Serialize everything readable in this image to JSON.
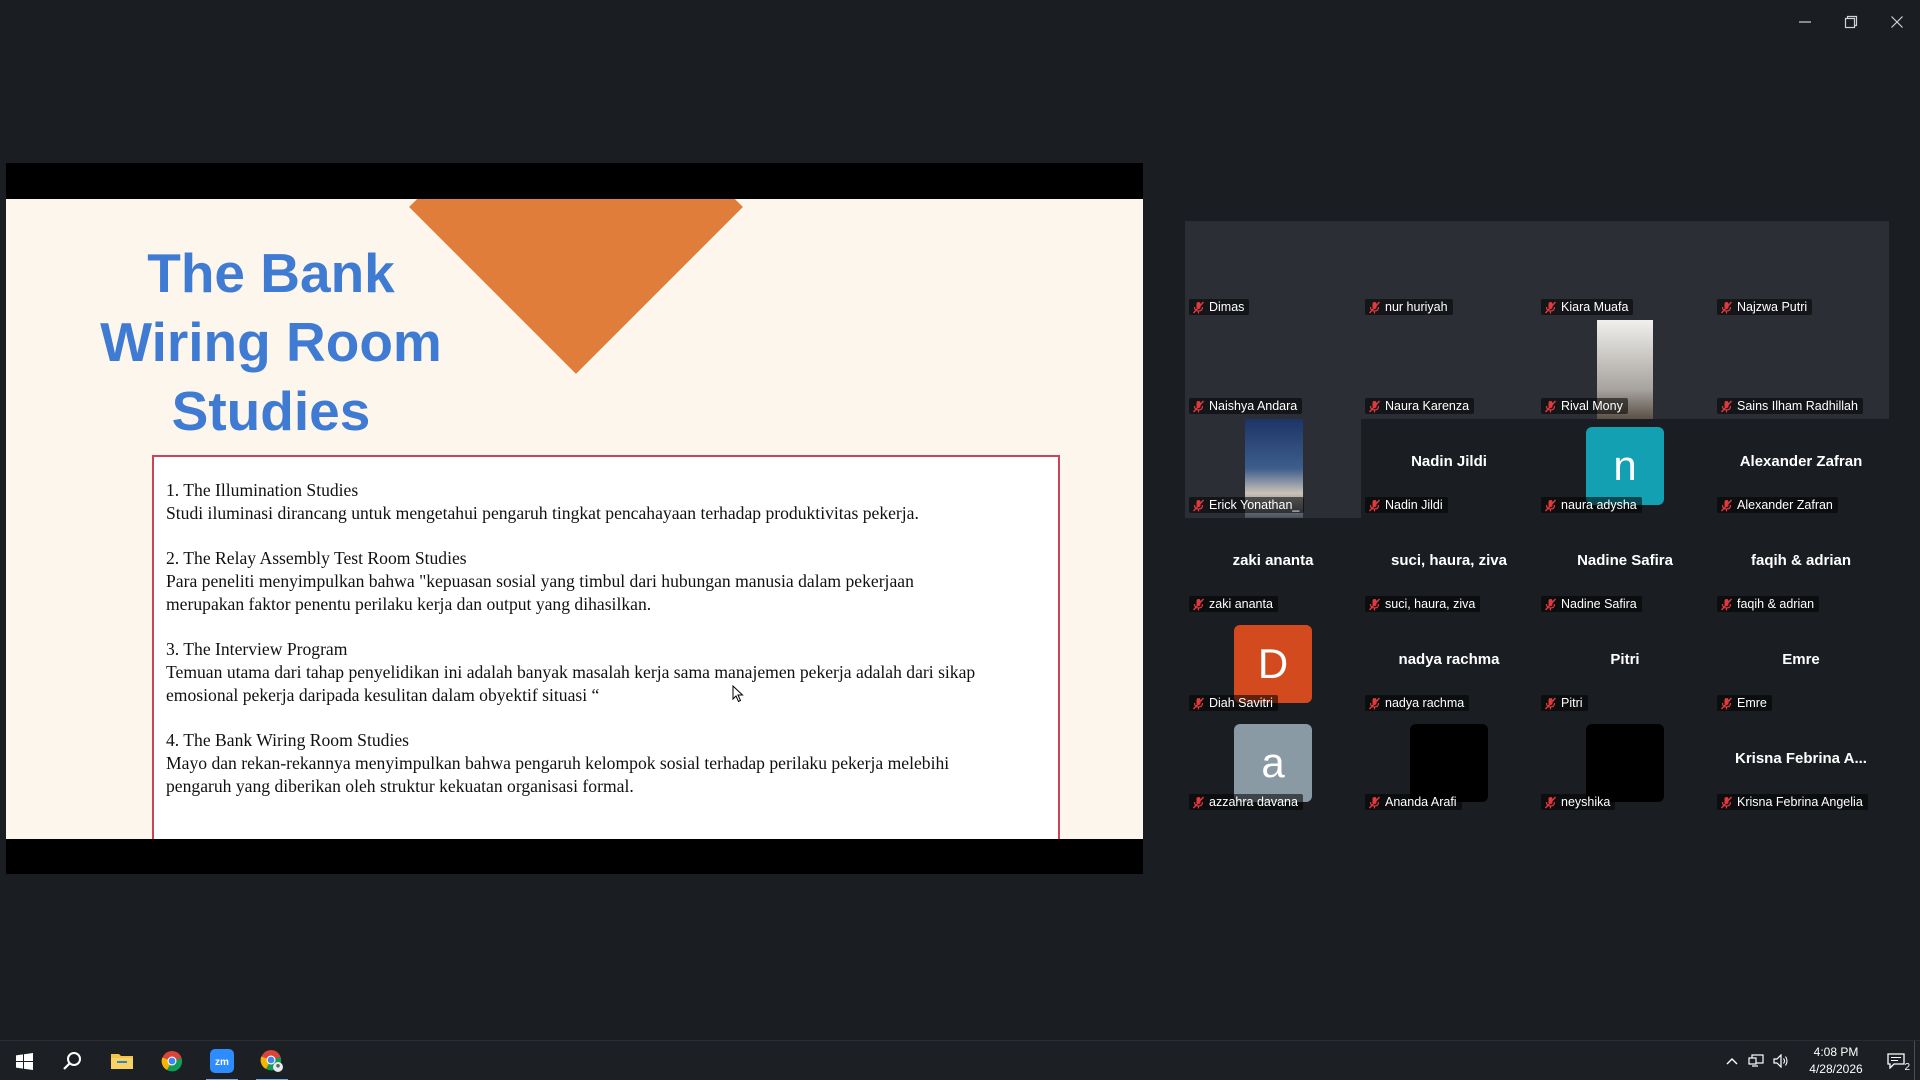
{
  "slide": {
    "title_lines": [
      "The Bank",
      "Wiring Room",
      "Studies"
    ],
    "paragraphs": [
      "1.   The Illumination Studies",
      "Studi iluminasi dirancang untuk mengetahui pengaruh tingkat pencahayaan terhadap produktivitas pekerja.",
      "2. The Relay Assembly Test Room Studies",
      "Para peneliti menyimpulkan bahwa \"kepuasan sosial yang timbul dari hubungan manusia dalam pekerjaan",
      "merupakan faktor penentu perilaku kerja dan output yang dihasilkan.",
      "3. The Interview Program",
      "Temuan utama dari tahap penyelidikan ini adalah banyak masalah kerja sama manajemen pekerja adalah dari sikap",
      "emosional pekerja daripada kesulitan dalam obyektif situasi “",
      "4. The Bank Wiring Room Studies",
      "Mayo dan rekan-rekannya menyimpulkan bahwa pengaruh kelompok sosial terhadap perilaku pekerja melebihi",
      "pengaruh yang diberikan oleh struktur kekuatan organisasi formal."
    ],
    "colors": {
      "title": "#3f7bd3",
      "diamond": "#e07d3a",
      "box_border": "#c9455a"
    }
  },
  "participants": [
    {
      "name": "Dimas",
      "type": "video"
    },
    {
      "name": "nur huriyah",
      "type": "video"
    },
    {
      "name": "Kiara Muafa",
      "type": "video"
    },
    {
      "name": "Najzwa Putri",
      "type": "video"
    },
    {
      "name": "Naishya Andara",
      "type": "video"
    },
    {
      "name": "Naura Karenza",
      "type": "video"
    },
    {
      "name": "Rival Mony",
      "type": "video"
    },
    {
      "name": "Sains Ilham Radhillah",
      "type": "video"
    },
    {
      "name": "Erick Yonathan_",
      "type": "video"
    },
    {
      "name": "Nadin Jildi",
      "type": "name",
      "center": "Nadin Jildi"
    },
    {
      "name": "naura adysha",
      "type": "avatar",
      "letter": "n",
      "color": "#14a0b3"
    },
    {
      "name": "Alexander Zafran",
      "type": "name",
      "center": "Alexander Zafran"
    },
    {
      "name": "zaki ananta",
      "type": "name",
      "center": "zaki ananta"
    },
    {
      "name": "suci, haura, ziva",
      "type": "name",
      "center": "suci, haura, ziva"
    },
    {
      "name": "Nadine Safira",
      "type": "name",
      "center": "Nadine Safira"
    },
    {
      "name": "faqih & adrian",
      "type": "name",
      "center": "faqih & adrian"
    },
    {
      "name": "Diah Savitri",
      "type": "avatar",
      "letter": "D",
      "color": "#d24a1e"
    },
    {
      "name": "nadya rachma",
      "type": "name",
      "center": "nadya rachma"
    },
    {
      "name": "Pitri",
      "type": "name",
      "center": "Pitri"
    },
    {
      "name": "Emre",
      "type": "name",
      "center": "Emre"
    },
    {
      "name": "azzahra davana",
      "type": "avatar",
      "letter": "a",
      "color": "#8a9aa5"
    },
    {
      "name": "Ananda Arafi",
      "type": "black"
    },
    {
      "name": "neyshika",
      "type": "black"
    },
    {
      "name": "Krisna Febrina Angelia",
      "type": "name",
      "center": "Krisna Febrina A..."
    }
  ],
  "taskbar": {
    "time": "4:08 PM",
    "date": "4/28/2026",
    "notification_count": "2",
    "apps": [
      "start-icon",
      "search-icon",
      "file-explorer-icon",
      "chrome-icon",
      "zoom-icon",
      "chrome-profile-icon"
    ]
  },
  "icons": {
    "muted_mic": "mic-muted-icon"
  }
}
